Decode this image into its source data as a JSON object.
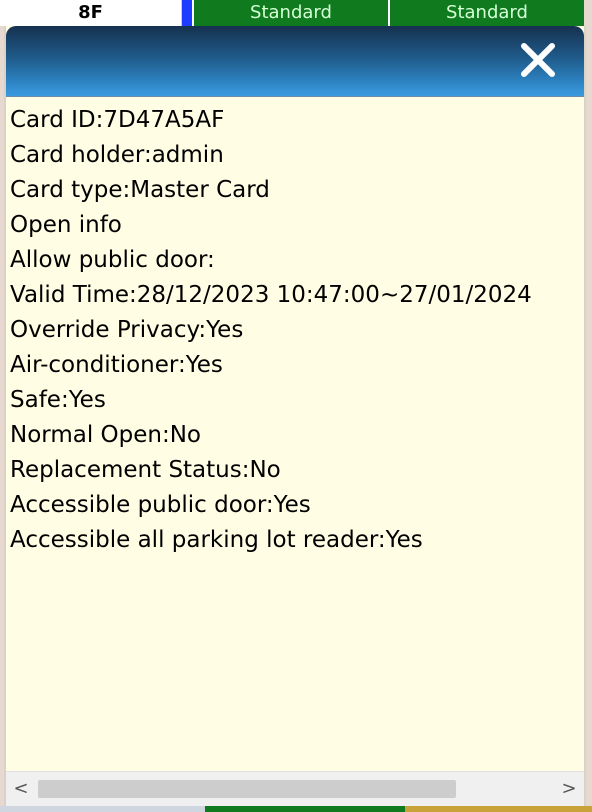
{
  "background": {
    "room_label": "8F",
    "cell_labels": [
      "Standard",
      "Standard"
    ]
  },
  "popup": {
    "close_icon": "close-icon",
    "lines": [
      "Card ID:7D47A5AF",
      "Card holder:admin",
      "Card type:Master Card",
      "Open info",
      "Allow public door:",
      "Valid Time:28/12/2023 10:47:00~27/01/2024",
      "Override Privacy:Yes",
      "Air-conditioner:Yes",
      "Safe:Yes",
      "Normal Open:No",
      "Replacement Status:No",
      "Accessible public door:Yes",
      "Accessible all parking lot reader:Yes"
    ]
  },
  "scrollbar": {
    "left_arrow": "<",
    "right_arrow": ">"
  },
  "colors": {
    "content_bg": "#fffde3",
    "titlebar_top": "#16314f",
    "titlebar_bottom": "#3a9be0",
    "grid_green": "#0f7a1e"
  }
}
